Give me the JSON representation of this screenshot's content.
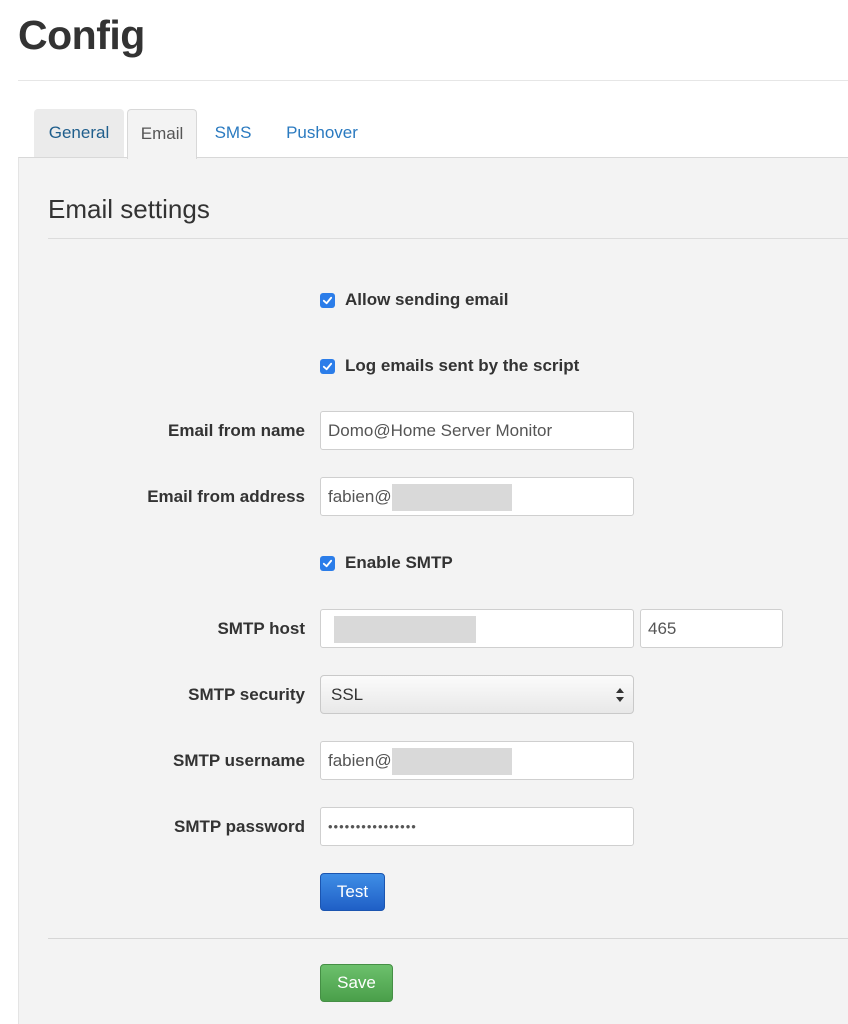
{
  "page": {
    "title": "Config"
  },
  "tabs": [
    {
      "label": "General",
      "active": false
    },
    {
      "label": "Email",
      "active": true
    },
    {
      "label": "SMS",
      "active": false
    },
    {
      "label": "Pushover",
      "active": false
    }
  ],
  "section": {
    "title": "Email settings"
  },
  "checkboxes": {
    "allow_sending": {
      "label": "Allow sending email",
      "checked": true
    },
    "log_emails": {
      "label": "Log emails sent by the script",
      "checked": true
    },
    "enable_smtp": {
      "label": "Enable SMTP",
      "checked": true
    }
  },
  "fields": {
    "from_name": {
      "label": "Email from name",
      "value": "Domo@Home Server Monitor"
    },
    "from_address": {
      "label": "Email from address",
      "value": "fabien@"
    },
    "smtp_host": {
      "label": "SMTP host",
      "value": "",
      "port": "465"
    },
    "smtp_security": {
      "label": "SMTP security",
      "value": "SSL"
    },
    "smtp_username": {
      "label": "SMTP username",
      "value": "fabien@"
    },
    "smtp_password": {
      "label": "SMTP password",
      "value": "••••••••••••••••"
    }
  },
  "buttons": {
    "test": "Test",
    "save": "Save"
  },
  "colors": {
    "primary": "#2b7de9",
    "success": "#5cb85c",
    "link": "#2a7ac0"
  }
}
